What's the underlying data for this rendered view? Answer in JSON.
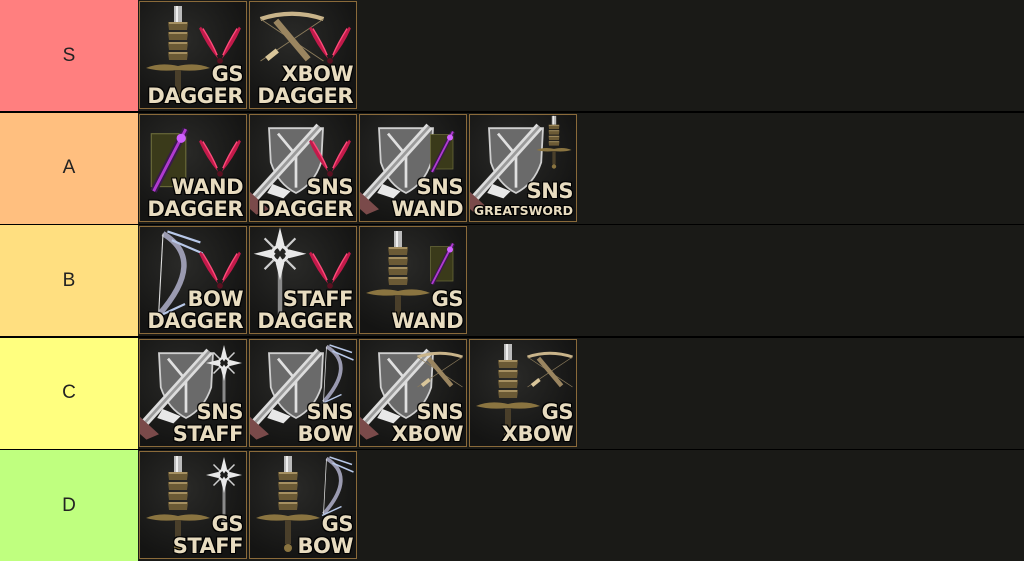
{
  "tiers": [
    {
      "label": "S",
      "color": "#ff7f7f",
      "items": [
        {
          "line1": "GS",
          "line2": "DAGGER",
          "primary": "greatsword",
          "secondary": "dagger"
        },
        {
          "line1": "XBOW",
          "line2": "DAGGER",
          "primary": "crossbow",
          "secondary": "dagger"
        }
      ]
    },
    {
      "label": "A",
      "color": "#ffbf7f",
      "items": [
        {
          "line1": "WAND",
          "line2": "DAGGER",
          "primary": "wand",
          "secondary": "dagger"
        },
        {
          "line1": "SNS",
          "line2": "DAGGER",
          "primary": "sns",
          "secondary": "dagger"
        },
        {
          "line1": "SNS",
          "line2": "WAND",
          "primary": "sns",
          "secondary": "wand"
        },
        {
          "line1": "SNS",
          "line2": "GREATSWORD",
          "primary": "sns",
          "secondary": "greatsword",
          "small": true
        }
      ]
    },
    {
      "label": "B",
      "color": "#ffdf80",
      "items": [
        {
          "line1": "BOW",
          "line2": "DAGGER",
          "primary": "bow",
          "secondary": "dagger"
        },
        {
          "line1": "STAFF",
          "line2": "DAGGER",
          "primary": "staff",
          "secondary": "dagger"
        },
        {
          "line1": "GS",
          "line2": "WAND",
          "primary": "greatsword",
          "secondary": "wand"
        }
      ]
    },
    {
      "label": "C",
      "color": "#ffff7f",
      "items": [
        {
          "line1": "SNS",
          "line2": "STAFF",
          "primary": "sns",
          "secondary": "staff"
        },
        {
          "line1": "SNS",
          "line2": "BOW",
          "primary": "sns",
          "secondary": "bow"
        },
        {
          "line1": "SNS",
          "line2": "XBOW",
          "primary": "sns",
          "secondary": "crossbow"
        },
        {
          "line1": "GS",
          "line2": "XBOW",
          "primary": "greatsword",
          "secondary": "crossbow"
        }
      ]
    },
    {
      "label": "D",
      "color": "#bfff7f",
      "items": [
        {
          "line1": "GS",
          "line2": "STAFF",
          "primary": "greatsword",
          "secondary": "staff"
        },
        {
          "line1": "GS",
          "line2": "BOW",
          "primary": "greatsword",
          "secondary": "bow"
        }
      ]
    }
  ]
}
